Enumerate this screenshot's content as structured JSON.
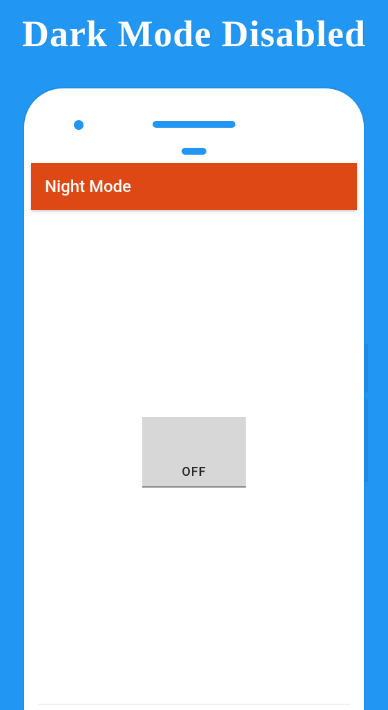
{
  "page": {
    "title": "Dark Mode Disabled"
  },
  "app": {
    "toolbar": {
      "title": "Night Mode"
    },
    "toggle": {
      "label": "OFF"
    }
  }
}
